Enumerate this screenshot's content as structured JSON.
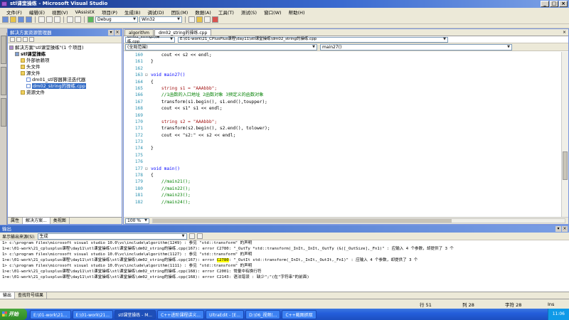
{
  "window": {
    "title": "stl课堂操练 - Microsoft Visual Studio",
    "controls": [
      "_",
      "□",
      "×"
    ]
  },
  "menu": {
    "items": [
      "文件(F)",
      "编辑(E)",
      "视图(V)",
      "VAssistX",
      "项目(P)",
      "生成(B)",
      "调试(D)",
      "团队(M)",
      "数据(A)",
      "工具(T)",
      "测试(S)",
      "窗口(W)",
      "帮助(H)"
    ]
  },
  "toolbar": {
    "config": "Debug",
    "platform": "Win32"
  },
  "solution_explorer": {
    "title": "解决方案资源管理器",
    "tree": [
      {
        "label": "解决方案\"stl课堂操练\"(1 个项目)",
        "type": "sol",
        "indent": 0
      },
      {
        "label": "stl课堂操练",
        "type": "proj",
        "indent": 1
      },
      {
        "label": "外部依赖项",
        "type": "folder",
        "indent": 2
      },
      {
        "label": "头文件",
        "type": "folder",
        "indent": 2
      },
      {
        "label": "源文件",
        "type": "folder",
        "indent": 2
      },
      {
        "label": "dm01_stl容器算法迭代器",
        "type": "file",
        "indent": 3
      },
      {
        "label": "dm02_string的操练.cpp",
        "type": "file",
        "indent": 3,
        "selected": true
      },
      {
        "label": "资源文件",
        "type": "folder",
        "indent": 2
      }
    ],
    "tabs": [
      "属性",
      "解决方案...",
      "类视图"
    ]
  },
  "editor": {
    "tabs": [
      "algorithm",
      "dm02_string的操练.cpp"
    ],
    "path": "E:\\01-work\\21_CPlusPlus课程\\day11\\stl课堂操练\\dm02_string的操练.cpp",
    "scope": "(全局范围)",
    "member": "main27()",
    "zoom": "100 %",
    "lines": [
      {
        "n": "160",
        "code": "    cout << s2 << endl;"
      },
      {
        "n": "161",
        "code": "}"
      },
      {
        "n": "162",
        "code": ""
      },
      {
        "n": "163",
        "code": "void main27()"
      },
      {
        "n": "164",
        "code": "{"
      },
      {
        "n": "165",
        "code": "    string s1 = \"AAAbbb\";"
      },
      {
        "n": "166",
        "code": "    //1函数的入口地址 2函数对象 3预定义的函数对象"
      },
      {
        "n": "167",
        "code": "    transform(s1.begin(), s1.end(),toupper);"
      },
      {
        "n": "168",
        "code": "    cout << s1\" s1 << endl;"
      },
      {
        "n": "169",
        "code": ""
      },
      {
        "n": "170",
        "code": "    string s2 = \"AAAbbb\";"
      },
      {
        "n": "171",
        "code": "    transform(s2.begin(), s2.end(), tolower);"
      },
      {
        "n": "172",
        "code": "    cout << \"s2:\" << s2 << endl;"
      },
      {
        "n": "173",
        "code": ""
      },
      {
        "n": "174",
        "code": "}"
      },
      {
        "n": "175",
        "code": ""
      },
      {
        "n": "176",
        "code": ""
      },
      {
        "n": "177",
        "code": "void main()"
      },
      {
        "n": "178",
        "code": "{"
      },
      {
        "n": "179",
        "code": "    //main21();"
      },
      {
        "n": "180",
        "code": "    //main22();"
      },
      {
        "n": "181",
        "code": "    //main23();"
      },
      {
        "n": "182",
        "code": "    //main24();"
      }
    ]
  },
  "output": {
    "title": "输出",
    "source_label": "显示输出来源(S):",
    "source_value": "生成",
    "lines": [
      "1>          c:\\program files\\microsoft visual studio 10.0\\vc\\include\\algorithm(1249) : 参见 \"std::transform\" 的声明",
      "1>e:\\01-work\\21_cplusplus课程\\day11\\stl课堂操练\\stl课堂操练\\dm02_string的操练.cpp(167): error C2780: \"_OutTy *std::transform(_InIt,_InIt,_OutTy (&)[_OutSize],_Fn1)\" : 应输入 4 个参数，却提供了 3 个",
      "1>          c:\\program files\\microsoft visual studio 10.0\\vc\\include\\algorithm(1127) : 参见 \"std::transform\" 的声明",
      "1>e:\\01-work\\21_cplusplus课程\\day11\\stl课堂操练\\stl课堂操练\\dm02_string的操练.cpp(167): error C2780: \"_OutIt std::transform(_InIt,_InIt,_OutIt,_Fn1)\" : 应输入 4 个参数，却提供了 3 个",
      "1>          c:\\program files\\microsoft visual studio 10.0\\vc\\include\\algorithm(1111) : 参见 \"std::transform\" 的声明",
      "1>e:\\01-work\\21_cplusplus课程\\day11\\stl课堂操练\\stl课堂操练\\dm02_string的操练.cpp(168): error C2001: 常量中有换行符",
      "1>e:\\01-work\\21_cplusplus课程\\day11\\stl课堂操练\\stl课堂操练\\dm02_string的操练.cpp(168): error C2143: 语法错误 : 缺少\";\"(在\"字符串\"的前面)"
    ],
    "tabs": [
      "输出",
      "查找符号结果"
    ]
  },
  "status": {
    "left": "",
    "line": "行 51",
    "col": "列 28",
    "ch": "字符 28",
    "mode": "Ins"
  },
  "taskbar": {
    "start": "开始",
    "tasks": [
      "E:\\01-work\\21...",
      "E:\\01-work\\21...",
      "stl课堂操练 - M...",
      "C++进阶课程讲义...",
      "UltraEdit - [E...",
      "D:\\06_视频(...",
      "C++截图抓取"
    ],
    "clock": "11:06"
  }
}
